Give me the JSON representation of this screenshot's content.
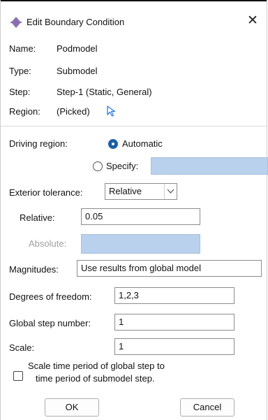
{
  "window": {
    "title": "Edit Boundary Condition",
    "close_symbol": "✕",
    "title_icon": "boundary-condition-icon"
  },
  "info": {
    "name_label": "Name:",
    "name_value": "Podmodel",
    "type_label": "Type:",
    "type_value": "Submodel",
    "step_label": "Step:",
    "step_value": "Step-1 (Static, General)",
    "region_label": "Region:",
    "region_value": "(Picked)",
    "region_icon": "arrow-cursor-icon"
  },
  "driving_region": {
    "label": "Driving region:",
    "automatic_label": "Automatic",
    "specify_label": "Specify:",
    "selected": "Automatic",
    "specify_value": ""
  },
  "exterior_tolerance": {
    "label": "Exterior tolerance:",
    "selected": "Relative",
    "relative_label": "Relative:",
    "relative_value": "0.05",
    "absolute_label": "Absolute:",
    "absolute_value": ""
  },
  "magnitudes": {
    "label": "Magnitudes:",
    "value": "Use results from global model"
  },
  "degrees_of_freedom": {
    "label": "Degrees of freedom:",
    "value": "1,2,3"
  },
  "global_step_number": {
    "label": "Global step number:",
    "value": "1"
  },
  "scale": {
    "label": "Scale:",
    "value": "1"
  },
  "scale_time": {
    "line1": "Scale time period of global step to",
    "line2": "time period of submodel step.",
    "checked": false
  },
  "buttons": {
    "ok_label": "OK",
    "cancel_label": "Cancel"
  },
  "colors": {
    "accent": "#1d5fa8",
    "disabled_field": "#b9d1ec",
    "pointer_icon": "#2a7de1"
  }
}
